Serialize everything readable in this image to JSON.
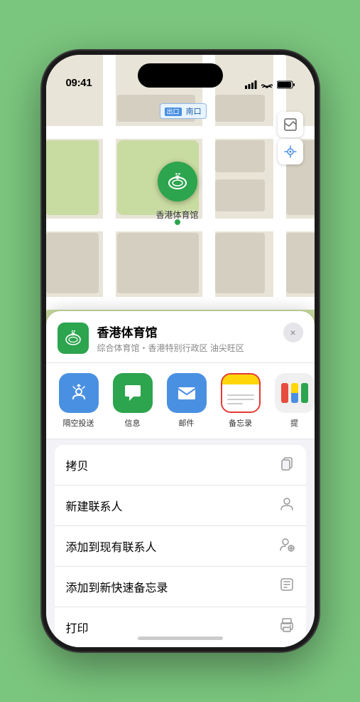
{
  "phone": {
    "status_bar": {
      "time": "09:41",
      "signal_bars": "signal-icon",
      "wifi": "wifi-icon",
      "battery": "battery-icon"
    },
    "map": {
      "label": "南口",
      "label_prefix": "出口",
      "venue_pin_label": "香港体育馆"
    },
    "venue_card": {
      "name": "香港体育馆",
      "subtitle": "综合体育馆・香港特别行政区 油尖旺区",
      "close_label": "×"
    },
    "share_items": [
      {
        "id": "airdrop",
        "label": "隔空投送",
        "icon_type": "airdrop"
      },
      {
        "id": "message",
        "label": "信息",
        "icon_type": "message"
      },
      {
        "id": "mail",
        "label": "邮件",
        "icon_type": "mail"
      },
      {
        "id": "notes",
        "label": "备忘录",
        "icon_type": "notes",
        "selected": true
      },
      {
        "id": "more",
        "label": "提",
        "icon_type": "more"
      }
    ],
    "action_items": [
      {
        "id": "copy",
        "label": "拷贝",
        "icon": "📋"
      },
      {
        "id": "new-contact",
        "label": "新建联系人",
        "icon": "👤"
      },
      {
        "id": "add-existing",
        "label": "添加到现有联系人",
        "icon": "👤+"
      },
      {
        "id": "add-notes",
        "label": "添加到新快速备忘录",
        "icon": "📝"
      },
      {
        "id": "print",
        "label": "打印",
        "icon": "🖨"
      }
    ]
  }
}
